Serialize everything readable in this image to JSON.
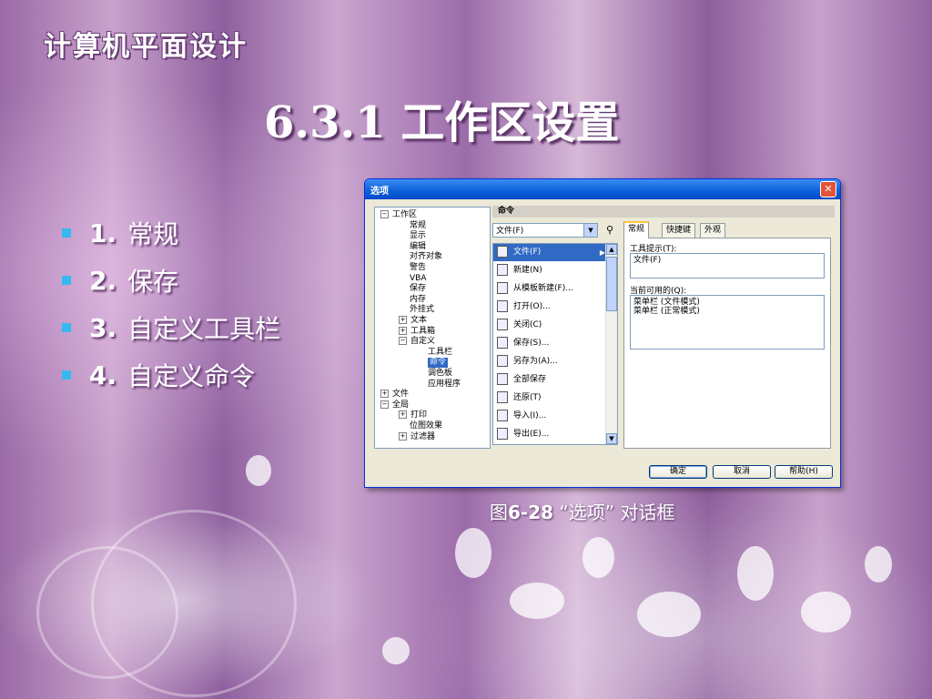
{
  "slide": {
    "brand": "计算机平面设计",
    "title": "6.3.1 工作区设置",
    "bullets": [
      {
        "num": "1.",
        "text": "常规"
      },
      {
        "num": "2.",
        "text": "保存"
      },
      {
        "num": "3.",
        "text": "自定义工具栏"
      },
      {
        "num": "4.",
        "text": "自定义命令"
      }
    ],
    "caption_prefix": "图",
    "caption_num": "6-28",
    "caption_text": " “选项” 对话框",
    "bullet_color": "#36b8f0"
  },
  "dialog": {
    "title": "选项",
    "close_glyph": "✕",
    "tree": [
      {
        "label": "工作区",
        "expander": "⊟",
        "level": 0
      },
      {
        "label": "常规",
        "level": 1
      },
      {
        "label": "显示",
        "level": 1
      },
      {
        "label": "编辑",
        "level": 1
      },
      {
        "label": "对齐对象",
        "level": 1
      },
      {
        "label": "警告",
        "level": 1
      },
      {
        "label": "VBA",
        "level": 1
      },
      {
        "label": "保存",
        "level": 1
      },
      {
        "label": "内存",
        "level": 1
      },
      {
        "label": "外挂式",
        "level": 1
      },
      {
        "label": "文本",
        "expander": "⊞",
        "level": 1
      },
      {
        "label": "工具箱",
        "expander": "⊞",
        "level": 1
      },
      {
        "label": "自定义",
        "expander": "⊟",
        "level": 1
      },
      {
        "label": "工具栏",
        "level": 2
      },
      {
        "label": "命令",
        "level": 2,
        "selected": true
      },
      {
        "label": "调色板",
        "level": 2
      },
      {
        "label": "应用程序",
        "level": 2
      },
      {
        "label": "文件",
        "expander": "⊞",
        "level": 0
      },
      {
        "label": "全局",
        "expander": "⊟",
        "level": 0
      },
      {
        "label": "打印",
        "expander": "⊞",
        "level": 1
      },
      {
        "label": "位图效果",
        "level": 1
      },
      {
        "label": "过滤器",
        "expander": "⊞",
        "level": 1
      }
    ],
    "section_header": "命令",
    "category_select": "文件(F)",
    "find_icon": "binoculars-icon",
    "commands": [
      {
        "label": "文件(F)",
        "selected": true,
        "submenu": true
      },
      {
        "label": "新建(N)"
      },
      {
        "label": "从模板新建(F)..."
      },
      {
        "label": "打开(O)..."
      },
      {
        "label": "关闭(C)"
      },
      {
        "label": "保存(S)..."
      },
      {
        "label": "另存为(A)..."
      },
      {
        "label": "全部保存"
      },
      {
        "label": "还原(T)"
      },
      {
        "label": "导入(I)..."
      },
      {
        "label": "导出(E)..."
      }
    ],
    "tabs": [
      "常规",
      "快捷键",
      "外观"
    ],
    "tooltip_label": "工具提示(T):",
    "tooltip_value": "文件(F)",
    "available_label": "当前可用的(Q):",
    "available_lines": [
      "菜单栏 (文件模式)",
      "菜单栏 (正常模式)"
    ],
    "buttons": {
      "ok": "确定",
      "cancel": "取消",
      "help": "帮助(H)"
    }
  }
}
